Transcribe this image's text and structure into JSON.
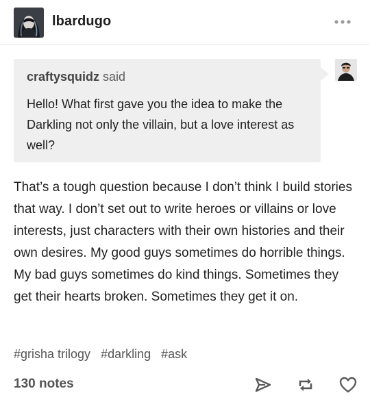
{
  "post": {
    "author": "lbardugo",
    "more_icon": "ellipsis-icon",
    "avatar_icon": "user-avatar"
  },
  "ask": {
    "asker": "craftysquidz",
    "said": "said",
    "question": "Hello! What first gave you the idea to make the Darkling not only the villain, but a love interest as well?",
    "asker_avatar_icon": "asker-avatar",
    "bubble_color": "#efefef"
  },
  "answer": {
    "text": "That’s a tough question because I don’t think I build stories that way. I don’t set out to write heroes or villains or love interests, just characters with their own histories and their own desires. My good guys sometimes do horrible things. My bad guys sometimes do kind things. Sometimes they get their hearts broken. Sometimes they get it on."
  },
  "tags": [
    "#grisha trilogy",
    "#darkling",
    "#ask"
  ],
  "footer": {
    "notes": "130 notes",
    "icons": [
      "share-icon",
      "reblog-icon",
      "like-icon"
    ]
  },
  "colors": {
    "text": "#1f1f1f",
    "muted": "#555555",
    "divider": "#e4e4e4"
  }
}
